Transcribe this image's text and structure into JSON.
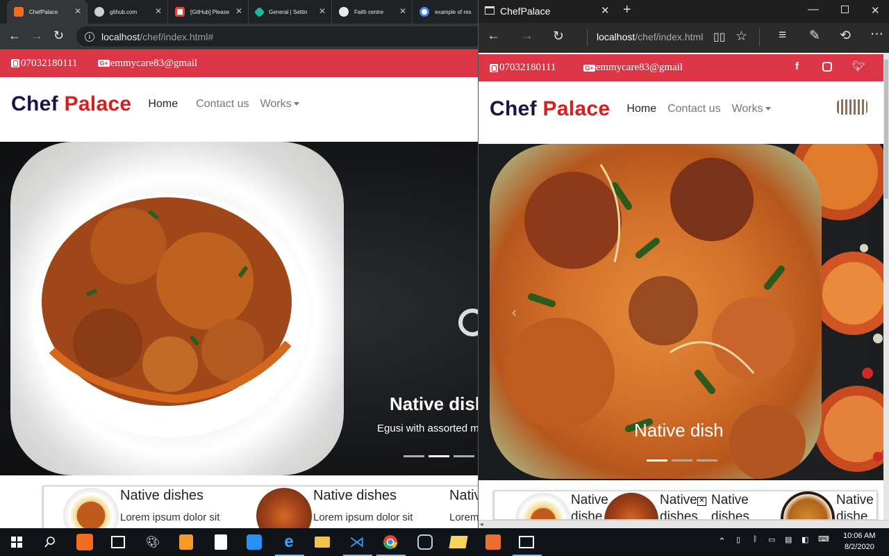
{
  "left_browser": {
    "tabs": [
      {
        "title": "ChefPalace",
        "fav_color": "#f26b21",
        "icon": "xampp-icon"
      },
      {
        "title": "github.com",
        "fav_color": "#cfcfcf",
        "icon": "github-icon"
      },
      {
        "title": "[GitHub] Please",
        "fav_color": "#ea4335",
        "icon": "gmail-icon"
      },
      {
        "title": "General | Settin",
        "fav_color": "#1abc9c",
        "icon": "diamond-icon"
      },
      {
        "title": "Faith centre",
        "fav_color": "#e8eaed",
        "icon": "globe-icon"
      },
      {
        "title": "example of res",
        "fav_color": "#4285f4",
        "icon": "google-icon"
      }
    ],
    "url_host": "localhost",
    "url_path": "/chef/index.html#"
  },
  "right_browser": {
    "window_title": "ChefPalace",
    "url_host": "localhost",
    "url_path": "/chef/index.html"
  },
  "site": {
    "phone": "07032180111",
    "email": "emmycare83@gmail",
    "brand_first": "Chef",
    "brand_second": "Palace",
    "nav": [
      "Home",
      "Contact us",
      "Works"
    ],
    "carousel_title": "Native dish",
    "carousel_caption": "Egusi with assorted m",
    "cards": [
      {
        "title": "Native dishes",
        "text": "Lorem ipsum dolor sit"
      },
      {
        "title": "Native dishes",
        "text": "Lorem ipsum dolor sit"
      },
      {
        "title": "Nativ",
        "text": "Lorem"
      }
    ],
    "right_cards": [
      {
        "l1": "Native",
        "l2": "dishe"
      },
      {
        "l1": "Native",
        "l2": "dishes"
      },
      {
        "l1": "Native",
        "l2": "dishes"
      },
      {
        "l1": "Native",
        "l2": "dishe"
      }
    ]
  },
  "taskbar": {
    "time": "10:06 AM",
    "date": "8/2/2020"
  },
  "colors": {
    "topbar_red": "#dc3545",
    "brand_navy": "#1a1446",
    "brand_red": "#d81e1e"
  }
}
